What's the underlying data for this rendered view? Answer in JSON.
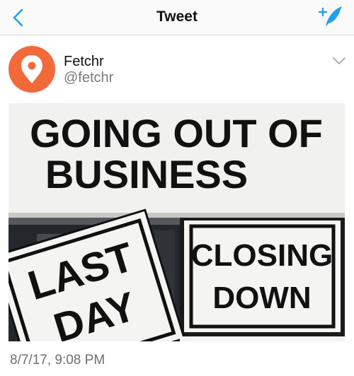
{
  "nav": {
    "title": "Tweet",
    "back_icon": "chevron-left-icon",
    "compose_icon": "compose-tweet-icon",
    "accent_color": "#1da1f2"
  },
  "tweet": {
    "author": {
      "display_name": "Fetchr",
      "handle": "@fetchr",
      "avatar_color": "#f26a3a"
    },
    "menu_icon": "chevron-down-icon",
    "photo": {
      "banner_line1": "GOING OUT OF",
      "banner_line2": "BUSINESS",
      "left_sign_line1": "LAST",
      "left_sign_line2": "DAY",
      "right_sign_line1": "CLOSING",
      "right_sign_line2": "DOWN"
    },
    "timestamp": "8/7/17, 9:08 PM"
  }
}
